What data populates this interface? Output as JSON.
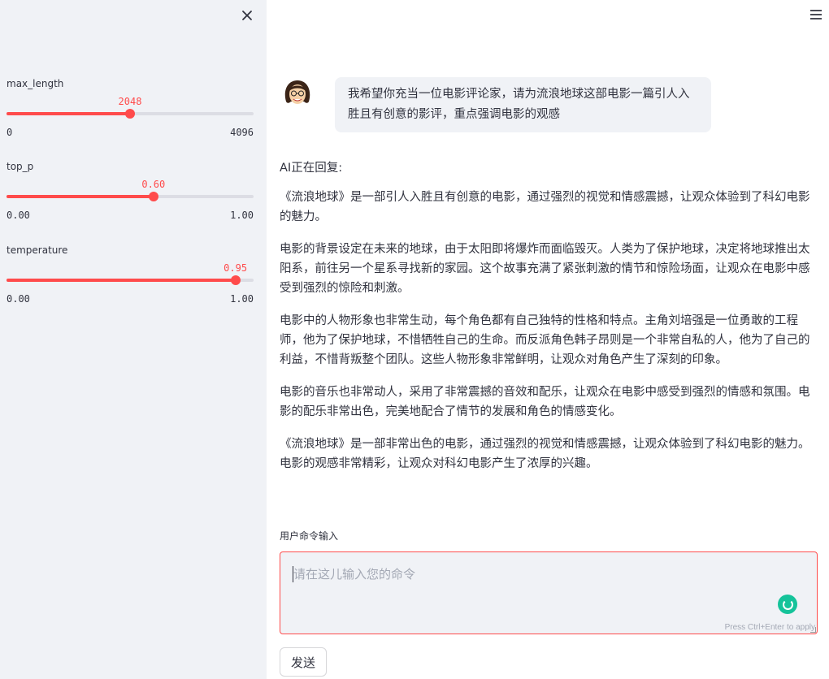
{
  "sidebar": {
    "close_icon": "close-icon",
    "sliders": {
      "max_length": {
        "label": "max_length",
        "value": 2048,
        "value_text": "2048",
        "min": 0,
        "max": 4096,
        "min_text": "0",
        "max_text": "4096"
      },
      "top_p": {
        "label": "top_p",
        "value": 0.6,
        "value_text": "0.60",
        "min": 0,
        "max": 1,
        "min_text": "0.00",
        "max_text": "1.00"
      },
      "temperature": {
        "label": "temperature",
        "value": 0.95,
        "value_text": "0.95",
        "min": 0,
        "max": 1,
        "min_text": "0.00",
        "max_text": "1.00"
      }
    }
  },
  "header": {
    "menu_icon": "hamburger-menu-icon"
  },
  "chat": {
    "user_message": "我希望你充当一位电影评论家，请为流浪地球这部电影一篇引人入胜且有创意的影评，重点强调电影的观感",
    "assistant_status": "AI正在回复:",
    "assistant_paragraphs": [
      "《流浪地球》是一部引人入胜且有创意的电影，通过强烈的视觉和情感震撼，让观众体验到了科幻电影的魅力。",
      "电影的背景设定在未来的地球，由于太阳即将爆炸而面临毁灭。人类为了保护地球，决定将地球推出太阳系，前往另一个星系寻找新的家园。这个故事充满了紧张刺激的情节和惊险场面，让观众在电影中感受到强烈的惊险和刺激。",
      "电影中的人物形象也非常生动，每个角色都有自己独特的性格和特点。主角刘培强是一位勇敢的工程师，他为了保护地球，不惜牺牲自己的生命。而反派角色韩子昂则是一个非常自私的人，他为了自己的利益，不惜背叛整个团队。这些人物形象非常鲜明，让观众对角色产生了深刻的印象。",
      "电影的音乐也非常动人，采用了非常震撼的音效和配乐，让观众在电影中感受到强烈的情感和氛围。电影的配乐非常出色，完美地配合了情节的发展和角色的情感变化。",
      "《流浪地球》是一部非常出色的电影，通过强烈的视觉和情感震撼，让观众体验到了科幻电影的魅力。电影的观感非常精彩，让观众对科幻电影产生了浓厚的兴趣。"
    ]
  },
  "input": {
    "label": "用户命令输入",
    "placeholder": "请在这儿输入您的命令",
    "hint": "Press Ctrl+Enter to apply",
    "send_label": "发送"
  },
  "colors": {
    "accent": "#ff4b4b",
    "sidebar_bg": "#f0f2f6",
    "text": "#31333f",
    "grammarly": "#15c39a"
  }
}
